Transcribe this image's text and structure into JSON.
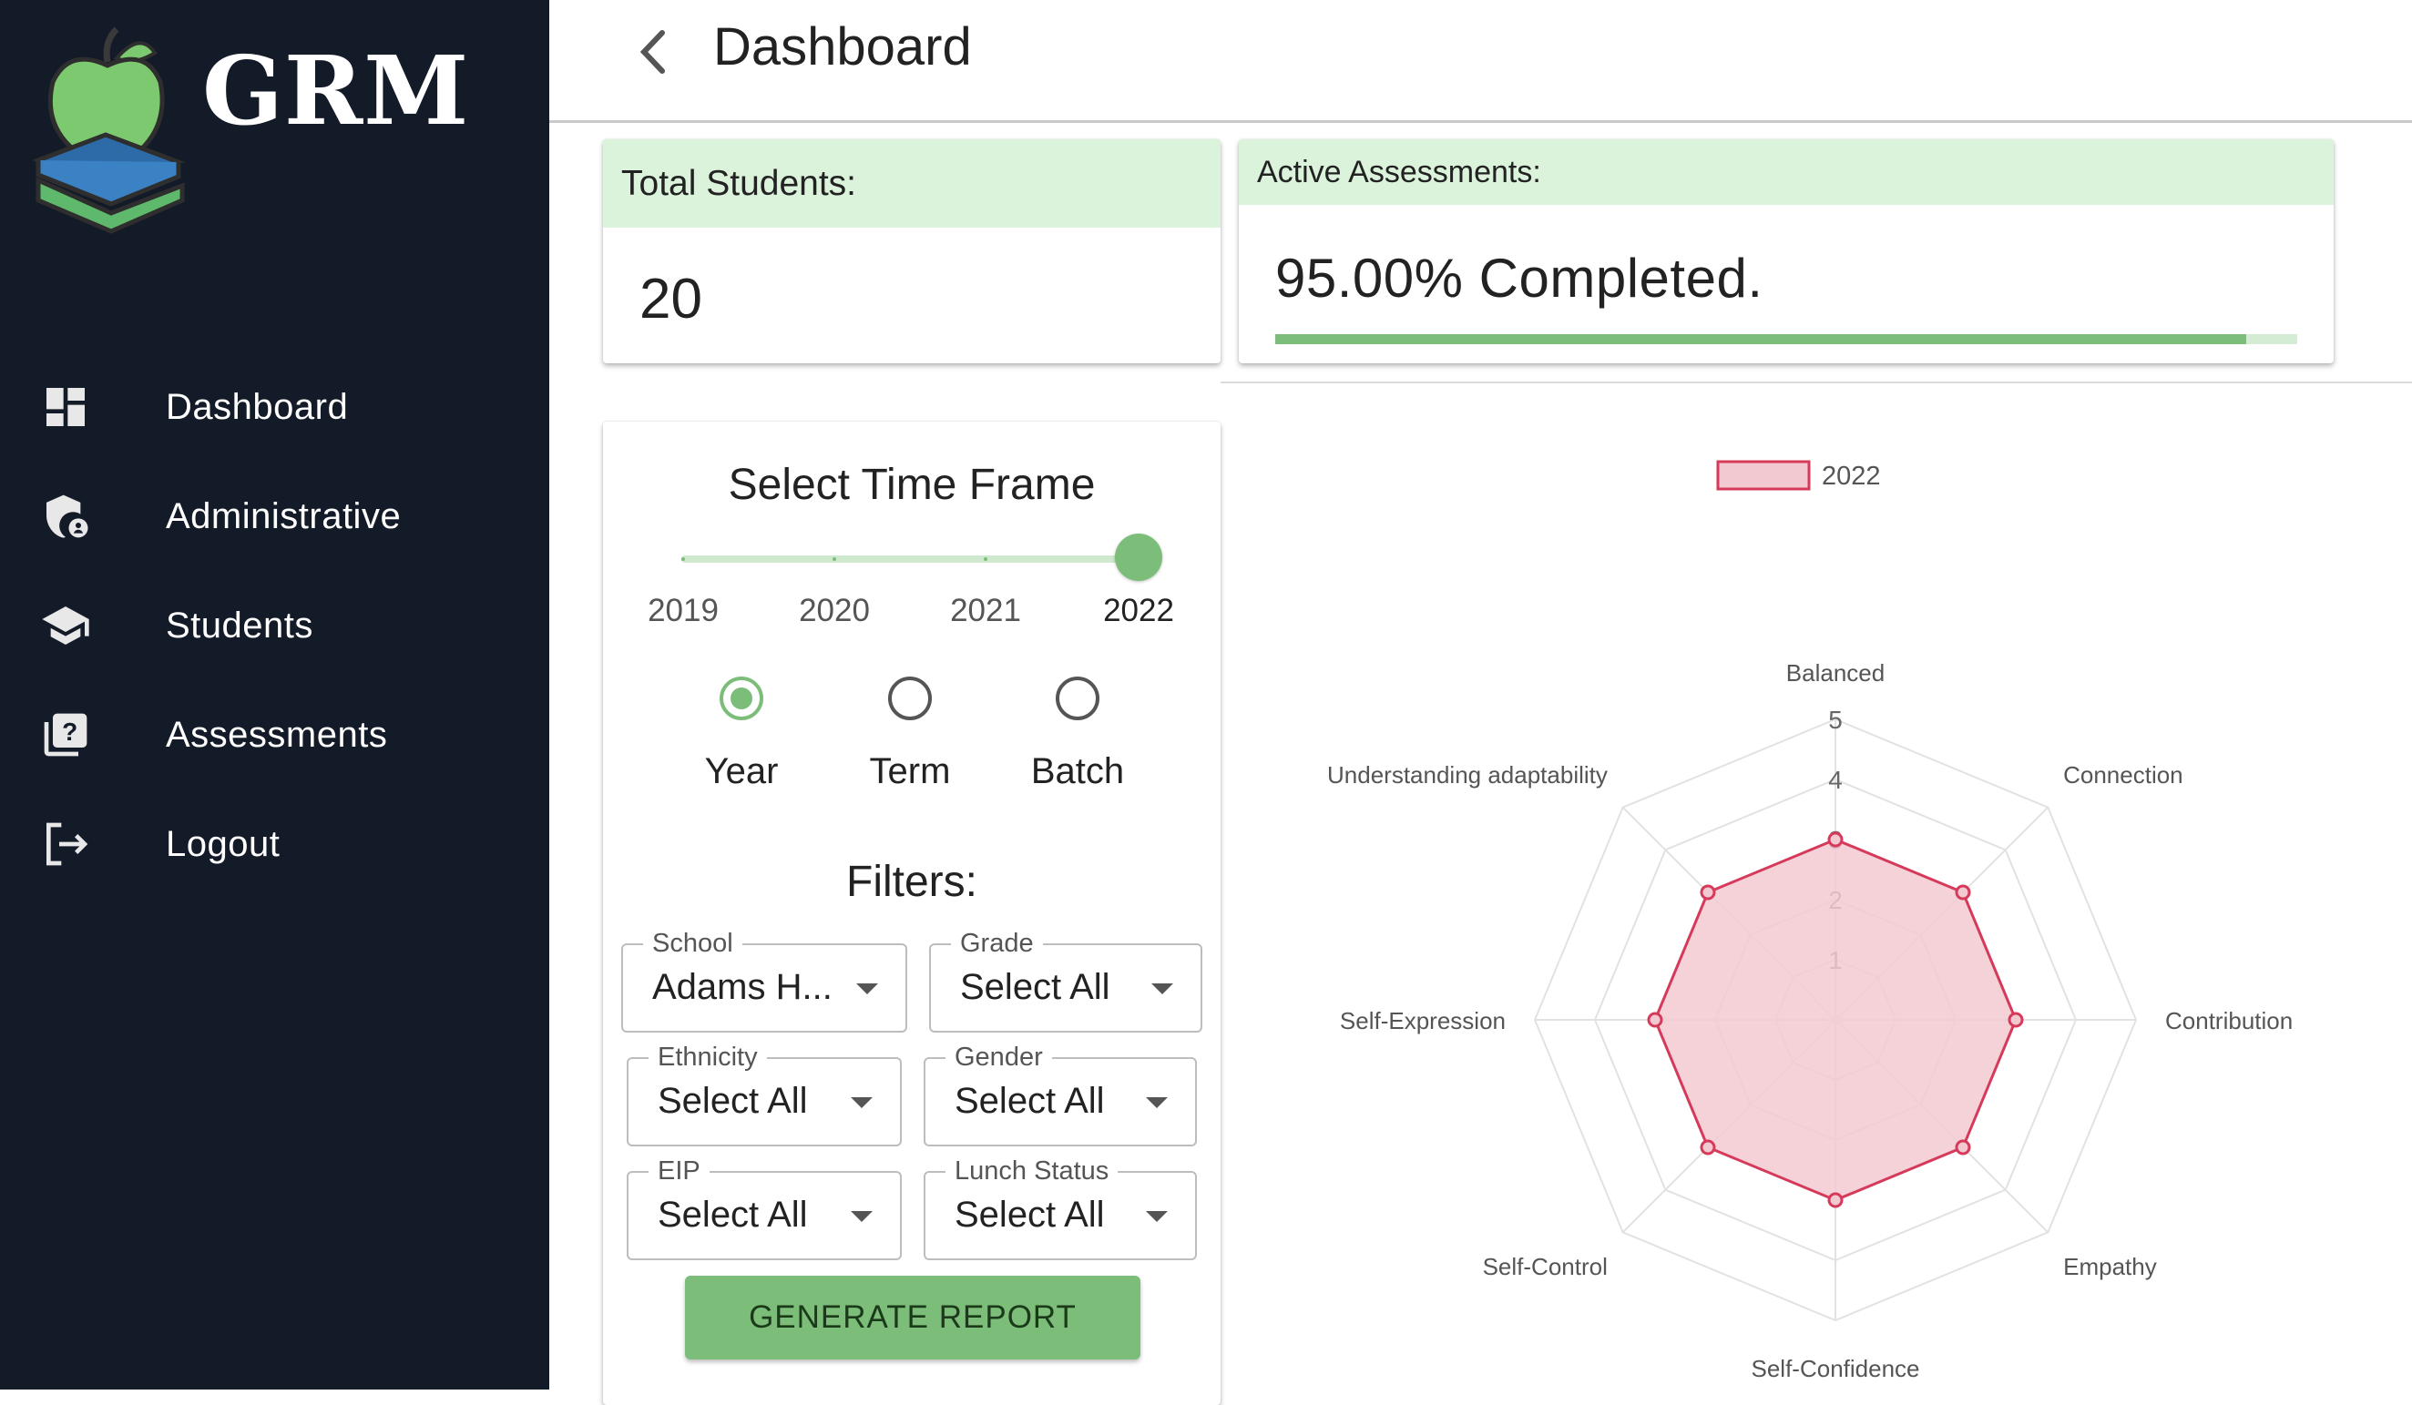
{
  "sidebar": {
    "brand": "GRM",
    "items": [
      {
        "label": "Dashboard",
        "icon": "dashboard-icon"
      },
      {
        "label": "Administrative",
        "icon": "admin-shield-icon"
      },
      {
        "label": "Students",
        "icon": "graduation-cap-icon"
      },
      {
        "label": "Assessments",
        "icon": "quiz-icon"
      },
      {
        "label": "Logout",
        "icon": "logout-icon"
      }
    ]
  },
  "header": {
    "title": "Dashboard",
    "back_icon": "chevron-left-icon"
  },
  "total_students": {
    "label": "Total Students:",
    "value": "20"
  },
  "active_assessments": {
    "label": "Active Assessments:",
    "value": "95.00% Completed.",
    "progress": 0.95
  },
  "time_frame": {
    "title": "Select Time Frame",
    "ticks": [
      "2019",
      "2020",
      "2021",
      "2022"
    ],
    "selected": "2022",
    "modes": [
      "Year",
      "Term",
      "Batch"
    ],
    "selected_mode": "Year"
  },
  "filters": {
    "title": "Filters:",
    "school": {
      "label": "School",
      "value": "Adams H..."
    },
    "grade": {
      "label": "Grade",
      "value": "Select All"
    },
    "ethnicity": {
      "label": "Ethnicity",
      "value": "Select All"
    },
    "gender": {
      "label": "Gender",
      "value": "Select All"
    },
    "eip": {
      "label": "EIP",
      "value": "Select All"
    },
    "lunch_status": {
      "label": "Lunch Status",
      "value": "Select All"
    }
  },
  "generate_button": "GENERATE REPORT",
  "colors": {
    "sidebar": "#131a28",
    "accent": "#7cbe79",
    "header_tint": "#dbf2db",
    "radar_line": "#d63a5a",
    "radar_fill": "#f3c9d1"
  },
  "chart_data": {
    "type": "radar",
    "axes": [
      "Balanced",
      "Connection",
      "Contribution",
      "Empathy",
      "Self-Confidence",
      "Self-Control",
      "Self-Expression",
      "Understanding adaptability"
    ],
    "ticks": [
      "1",
      "2",
      "3",
      "4",
      "5"
    ],
    "rmax": 5,
    "legend_position": "top",
    "series": [
      {
        "name": "2022",
        "values": [
          3.0,
          3.0,
          3.0,
          3.0,
          3.0,
          3.0,
          3.0,
          3.0
        ]
      }
    ]
  }
}
